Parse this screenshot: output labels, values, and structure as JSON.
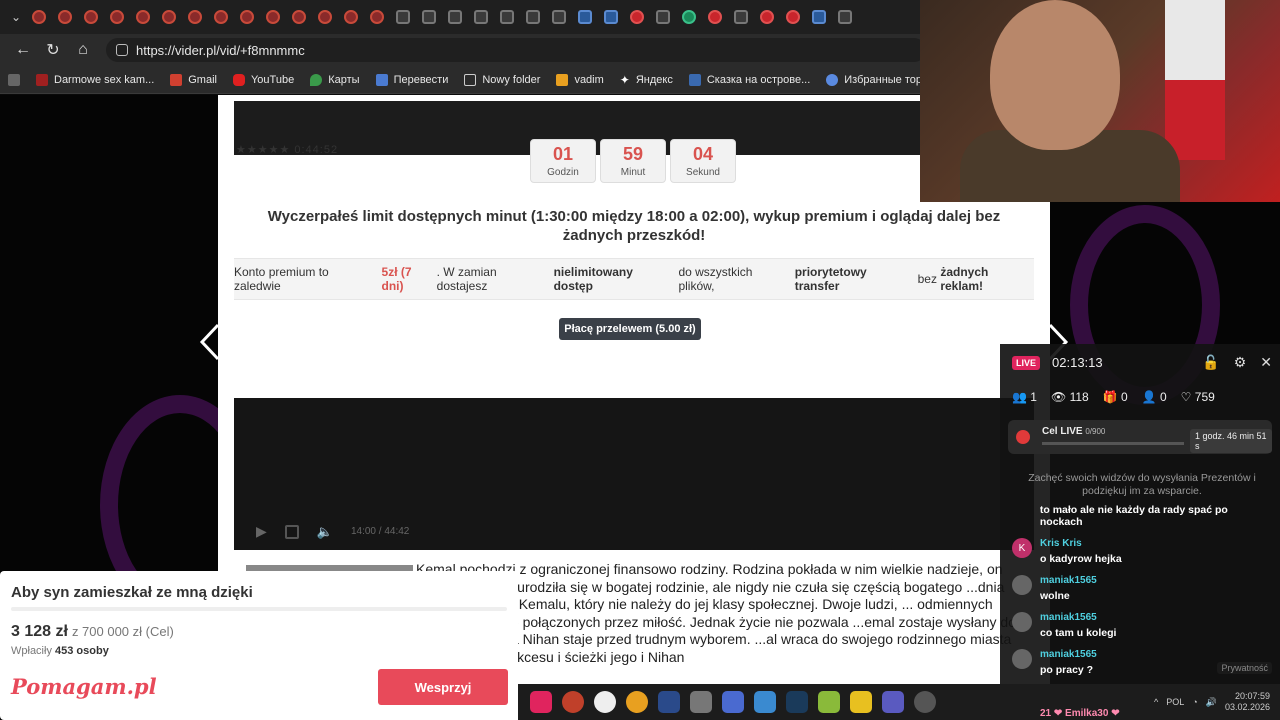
{
  "browser": {
    "url": "https://vider.pl/vid/+f8mnmmc",
    "bookmarks": [
      "Darmowe sex kam...",
      "Gmail",
      "YouTube",
      "Карты",
      "Перевести",
      "Nowy folder",
      "vadim",
      "Яндекс",
      "Сказка на острове...",
      "Избранные торре..."
    ]
  },
  "timer": {
    "hours": "01",
    "hours_label": "Godzin",
    "minutes": "59",
    "minutes_label": "Minut",
    "seconds": "04",
    "seconds_label": "Sekund"
  },
  "stars_text": "★★★★★ 0:44:52",
  "limit_message": "Wyczerpałeś limit dostępnych minut (1:30:00 między 18:00 a 02:00), wykup premium i oglądaj dalej bez żadnych przeszkód!",
  "premium": {
    "prefix": "Konto premium to zaledwie ",
    "price": "5zł (7 dni)",
    "mid1": ". W zamian dostajesz ",
    "unlimited": "nielimitowany dostęp",
    "mid2": " do wszystkich plików, ",
    "priority": "priorytetowy transfer",
    "mid3": " bez ",
    "noads": "żadnych reklam!",
    "button": "Płacę przelewem (5.00 zł)"
  },
  "player": {
    "time_current": "14:00",
    "time_sep": "/",
    "time_total": "44:42"
  },
  "description": "Kemal pochodzi z ograniczonej finansowo rodziny. Rodzina pokłada w nim wielkie nadzieje, on jednak ... Nihan urodziła się w bogatej rodzinie, ale nigdy nie czuła się częścią bogatego ...dnia zakochuje się w Kemalu, który nie należy do jej klasy społecznej. Dwoje ludzi, ... odmiennych światach zostaje połączonych przez miłość. Jednak życie nie pozwala ...emal zostaje wysłany do innego miasta, a Nihan staje przed trudnym wyborem. ...al wraca do swojego rodzinnego miasta jako człowiek sukcesu i ścieżki jego i Nihan",
  "donation": {
    "title": "Aby syn zamieszkał ze mną dzięki",
    "amount": "3 128 zł",
    "goal": "z 700 000 zł (Cel)",
    "payers_label": "Wpłaciły ",
    "payers_value": "453 osoby",
    "logo": "Pomagam.pl",
    "button": "Wesprzyj"
  },
  "live": {
    "badge": "LIVE",
    "time": "02:13:13",
    "stats": {
      "users": "1",
      "views": "118",
      "gifts": "0",
      "follows": "0",
      "likes": "759"
    },
    "goal_label": "Cel LIVE",
    "goal_progress": "0/900",
    "goal_time": "1 godz. 46 min 51 s",
    "hint": "Zachęć swoich widzów do wysyłania Prezentów i podziękuj im za wsparcie.",
    "messages": [
      {
        "user": "",
        "text": "to mało ale nie każdy da rady spać po nockach"
      },
      {
        "user": "Kris Kris",
        "text": "o kadyrow hejka"
      },
      {
        "user": "maniak1565",
        "text": "wolne"
      },
      {
        "user": "maniak1565",
        "text": "co tam u kolegi"
      },
      {
        "user": "maniak1565",
        "text": "po pracy ?"
      }
    ],
    "privacy": "Prywatność",
    "gift_line": "21 ❤ Emilka30 ❤"
  },
  "taskbar": {
    "lang": "POL",
    "time": "20:07:59",
    "date": "03.02.2026"
  }
}
